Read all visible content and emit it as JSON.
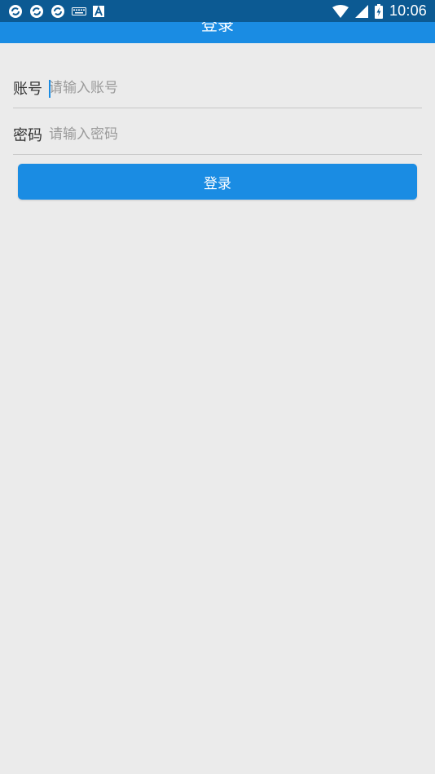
{
  "status_bar": {
    "time": "10:06",
    "left_icons": [
      "sync-icon",
      "sync-icon",
      "sync-icon",
      "keyboard-icon",
      "text-format-icon"
    ],
    "right_icons": [
      "wifi-icon",
      "cell-signal-icon",
      "battery-charging-icon"
    ]
  },
  "app_bar": {
    "title": "登录"
  },
  "form": {
    "account": {
      "label": "账号",
      "placeholder": "请输入账号",
      "value": ""
    },
    "password": {
      "label": "密码",
      "placeholder": "请输入密码",
      "value": ""
    }
  },
  "login_button": {
    "label": "登录"
  },
  "colors": {
    "status_bar": "#0c5a93",
    "primary": "#1a8ce3",
    "background": "#ebebeb",
    "divider": "#c6c6c6",
    "placeholder": "#9a9a9a"
  }
}
